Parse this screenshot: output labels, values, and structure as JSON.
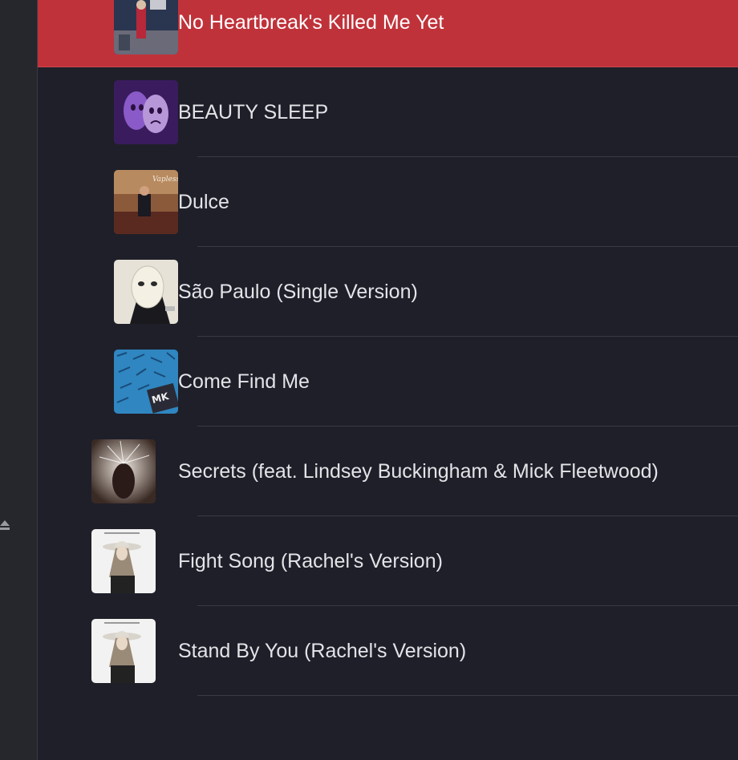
{
  "tracks": [
    {
      "title": "No Heartbreak's Killed Me Yet",
      "art_icon": "album-art-painting",
      "selected": true
    },
    {
      "title": "BEAUTY SLEEP",
      "art_icon": "album-art-purple-masks",
      "selected": false
    },
    {
      "title": "Dulce",
      "art_icon": "album-art-vinyl-room",
      "selected": false
    },
    {
      "title": "São Paulo (Single Version)",
      "art_icon": "album-art-white-mask",
      "selected": false
    },
    {
      "title": "Come Find Me",
      "art_icon": "album-art-blue-pattern",
      "selected": false
    },
    {
      "title": "Secrets (feat. Lindsey Buckingham & Mick Fleetwood)",
      "art_icon": "album-art-silhouette",
      "selected": false
    },
    {
      "title": "Fight Song (Rachel's Version)",
      "art_icon": "album-art-woman-hat",
      "selected": false
    },
    {
      "title": "Stand By You (Rachel's Version)",
      "art_icon": "album-art-woman-hat",
      "selected": false
    }
  ],
  "colors": {
    "selected_row": "#c0323a",
    "background": "#1f1f29"
  }
}
